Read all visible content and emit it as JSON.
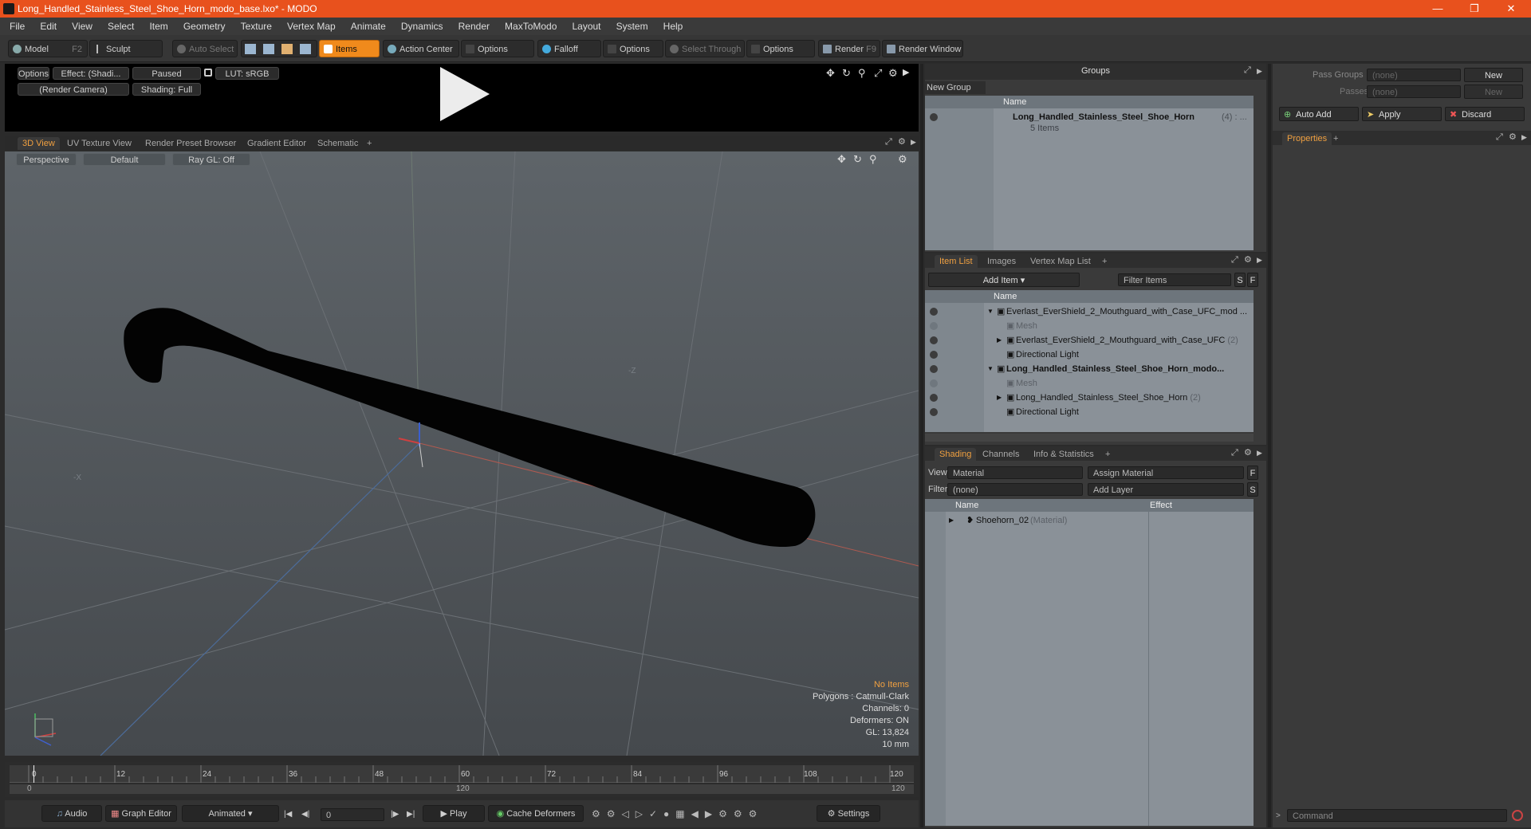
{
  "window": {
    "title": "Long_Handled_Stainless_Steel_Shoe_Horn_modo_base.lxo* - MODO",
    "controls": [
      "minimize-icon",
      "restore-icon",
      "close-icon"
    ]
  },
  "menu": [
    "File",
    "Edit",
    "View",
    "Select",
    "Item",
    "Geometry",
    "Texture",
    "Vertex Map",
    "Animate",
    "Dynamics",
    "Render",
    "MaxToModo",
    "Layout",
    "System",
    "Help"
  ],
  "toolbar": {
    "model": "Model",
    "model_key": "F2",
    "sculpt": "Sculpt",
    "auto_select": "Auto Select",
    "items": "Items",
    "action_center": "Action Center",
    "options1": "Options",
    "falloff": "Falloff",
    "options2": "Options",
    "select_through": "Select Through",
    "options3": "Options",
    "render": "Render",
    "render_key": "F9",
    "render_window": "Render Window"
  },
  "player": {
    "options": "Options",
    "effect": "Effect: (Shadi...",
    "paused": "Paused",
    "lut": "LUT: sRGB",
    "camera": "(Render Camera)",
    "shading": "Shading: Full"
  },
  "viewport_tabs": [
    "3D View",
    "UV Texture View",
    "Render Preset Browser",
    "Gradient Editor",
    "Schematic",
    "+"
  ],
  "viewport": {
    "perspective": "Perspective",
    "default": "Default",
    "raygl": "Ray GL: Off",
    "axis_neg_z": "-Z",
    "axis_neg_x": "-X",
    "hud": {
      "no_items": "No Items",
      "polygons": "Polygons : Catmull-Clark",
      "channels": "Channels: 0",
      "deformers": "Deformers: ON",
      "gl": "GL: 13,824",
      "scale": "10 mm"
    }
  },
  "timeline": {
    "ticks": [
      "0",
      "12",
      "24",
      "36",
      "48",
      "60",
      "72",
      "84",
      "96",
      "108",
      "120"
    ],
    "range_start": "0",
    "range_mid": "120",
    "range_end": "120"
  },
  "bottom": {
    "audio": "Audio",
    "graph_editor": "Graph Editor",
    "animated": "Animated",
    "frame": "0",
    "play": "Play",
    "cache_deformers": "Cache Deformers",
    "settings": "Settings"
  },
  "groups": {
    "title": "Groups",
    "new_group": "New Group",
    "col_name": "Name",
    "item_name": "Long_Handled_Stainless_Steel_Shoe_Horn",
    "item_count": "(4) : ...",
    "item_sub": "5 Items"
  },
  "itemlist": {
    "tabs": [
      "Item List",
      "Images",
      "Vertex Map List",
      "+"
    ],
    "add_item": "Add Item",
    "filter_items": "Filter Items",
    "s": "S",
    "f": "F",
    "col_name": "Name",
    "rows": [
      {
        "text": "Everlast_EverShield_2_Mouthguard_with_Case_UFC_mod ...",
        "indent": 0,
        "arrow": "▼",
        "dim": false,
        "bold": false
      },
      {
        "text": "Mesh",
        "indent": 1,
        "arrow": "",
        "dim": true,
        "bold": false
      },
      {
        "text": "Everlast_EverShield_2_Mouthguard_with_Case_UFC",
        "suffix": " (2)",
        "indent": 1,
        "arrow": "▶",
        "dim": false,
        "bold": false
      },
      {
        "text": "Directional Light",
        "indent": 1,
        "arrow": "",
        "dim": false,
        "bold": false
      },
      {
        "text": "Long_Handled_Stainless_Steel_Shoe_Horn_modo...",
        "indent": 0,
        "arrow": "▼",
        "dim": false,
        "bold": true
      },
      {
        "text": "Mesh",
        "indent": 1,
        "arrow": "",
        "dim": true,
        "bold": false
      },
      {
        "text": "Long_Handled_Stainless_Steel_Shoe_Horn",
        "suffix": " (2)",
        "indent": 1,
        "arrow": "▶",
        "dim": false,
        "bold": false
      },
      {
        "text": "Directional Light",
        "indent": 1,
        "arrow": "",
        "dim": false,
        "bold": false
      }
    ]
  },
  "shading": {
    "tabs": [
      "Shading",
      "Channels",
      "Info & Statistics",
      "+"
    ],
    "view_label": "View",
    "view_value": "Material",
    "assign_material": "Assign Material",
    "filter_label": "Filter",
    "filter_value": "(none)",
    "add_layer": "Add Layer",
    "f": "F",
    "s": "S",
    "col_name": "Name",
    "col_effect": "Effect",
    "row_name": "Shoehorn_02",
    "row_type": "(Material)"
  },
  "right": {
    "pass_groups": "Pass Groups",
    "pass_groups_value": "(none)",
    "new1": "New",
    "passes": "Passes",
    "passes_value": "(none)",
    "new2": "New",
    "auto_add": "Auto Add",
    "apply": "Apply",
    "discard": "Discard",
    "properties": "Properties",
    "plus": "+",
    "command": "Command"
  },
  "colors": {
    "accent": "#f08a1c",
    "titlebar": "#e8511d",
    "list_bg": "#8a9198"
  }
}
